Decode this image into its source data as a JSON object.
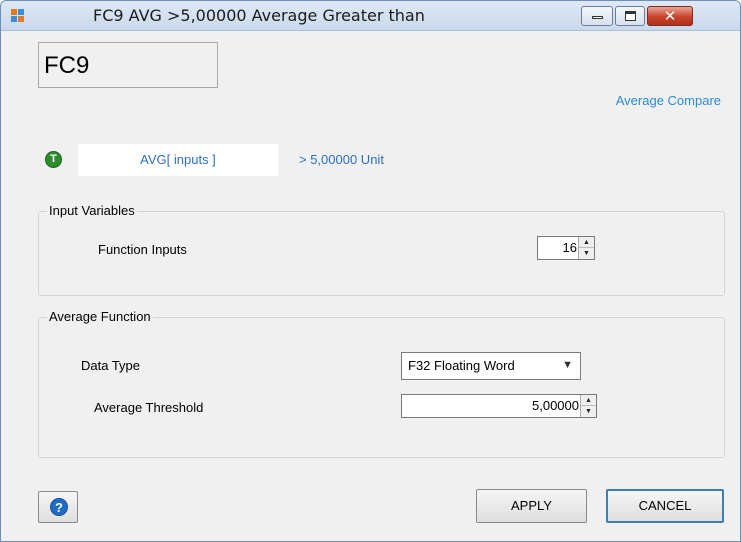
{
  "window": {
    "title": "FC9 AVG >5,00000 Average Greater than",
    "controls": {
      "minimize_icon": "minimize-icon",
      "maximize_icon": "maximize-icon",
      "close_glyph": "✕"
    }
  },
  "header": {
    "name": "FC9",
    "link": "Average Compare",
    "status_icon_glyph": "T",
    "expression": "AVG[ inputs ]",
    "condition": "> 5,00000 Unit"
  },
  "input_variables": {
    "title": "Input Variables",
    "function_inputs_label": "Function Inputs",
    "function_inputs_value": "16"
  },
  "average_function": {
    "title": "Average Function",
    "data_type_label": "Data Type",
    "data_type_value": "F32 Floating Word",
    "threshold_label": "Average Threshold",
    "threshold_value": "5,00000"
  },
  "footer": {
    "help_glyph": "?",
    "apply_label": "APPLY",
    "cancel_label": "CANCEL"
  },
  "colors": {
    "accent_link": "#2a8ae0",
    "status_green": "#2e8b2e",
    "help_blue": "#1f6cc7",
    "close_red": "#c8412b"
  }
}
